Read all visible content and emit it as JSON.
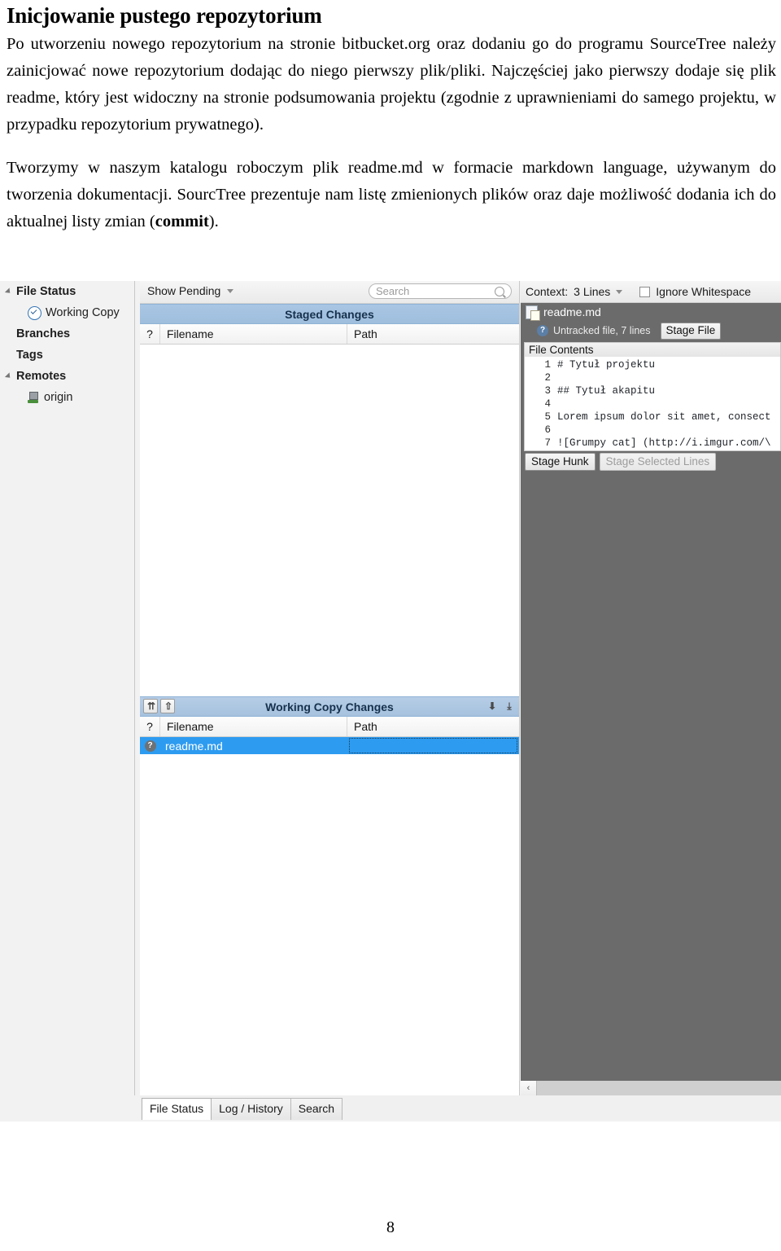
{
  "document": {
    "title": "Inicjowanie pustego repozytorium",
    "paragraph1": "Po utworzeniu nowego repozytorium na stronie bitbucket.org oraz dodaniu go do programu SourceTree należy zainicjować nowe repozytorium dodając do niego pierwszy plik/pliki. Najczęściej jako pierwszy dodaje się plik readme, który jest widoczny na stronie podsumowania projektu (zgodnie z uprawnieniami do samego projektu, w przypadku repozytorium prywatnego).",
    "paragraph2_pre": "Tworzymy w naszym katalogu roboczym plik readme.md w formacie markdown language, używanym do tworzenia dokumentacji. SourcTree prezentuje nam listę zmienionych plików oraz daje możliwość dodania ich do aktualnej listy zmian (",
    "paragraph2_bold": "commit",
    "paragraph2_post": ").",
    "page_number": "8"
  },
  "app": {
    "sidebar": {
      "items": [
        {
          "label": "File Status",
          "icon": "expand-triangle-icon",
          "level": "root"
        },
        {
          "label": "Working Copy",
          "icon": "check-circle-icon",
          "level": "child"
        },
        {
          "label": "Branches",
          "icon": "none",
          "level": "root"
        },
        {
          "label": "Tags",
          "icon": "none",
          "level": "root"
        },
        {
          "label": "Remotes",
          "icon": "expand-triangle-icon",
          "level": "root"
        },
        {
          "label": "origin",
          "icon": "server-icon",
          "level": "child"
        }
      ]
    },
    "middle": {
      "filter_label": "Show Pending",
      "search_placeholder": "Search",
      "search_value": "",
      "staged_section_title": "Staged Changes",
      "working_section_title": "Working Copy Changes",
      "columns": {
        "status": "?",
        "filename": "Filename",
        "path": "Path"
      },
      "staged_rows": [],
      "working_rows": [
        {
          "status": "?",
          "filename": "readme.md",
          "path": "",
          "selected": true
        }
      ],
      "unstage_all_icon": "double-up-arrow-icon",
      "unstage_icon": "up-arrow-icon",
      "stage_icon": "down-arrow-icon",
      "stage_all_icon": "double-down-arrow-icon"
    },
    "right": {
      "context_label": "Context:",
      "context_value": "3 Lines",
      "ignore_whitespace_label": "Ignore Whitespace",
      "ignore_whitespace_checked": false,
      "file_name": "readme.md",
      "file_status": "Untracked file, 7 lines",
      "stage_file_button": "Stage File",
      "contents_title": "File Contents",
      "lines": [
        {
          "n": "1",
          "text": "# Tytuł projektu"
        },
        {
          "n": "2",
          "text": ""
        },
        {
          "n": "3",
          "text": "## Tytuł akapitu"
        },
        {
          "n": "4",
          "text": ""
        },
        {
          "n": "5",
          "text": "Lorem ipsum dolor sit amet, consect"
        },
        {
          "n": "6",
          "text": ""
        },
        {
          "n": "7",
          "text": "![Grumpy cat] (http://i.imgur.com/\\"
        }
      ],
      "stage_hunk_button": "Stage Hunk",
      "stage_selected_lines_button": "Stage Selected Lines",
      "scroll_left_icon": "chevron-left-icon"
    },
    "tabs": [
      {
        "label": "File Status",
        "active": true
      },
      {
        "label": "Log / History",
        "active": false
      },
      {
        "label": "Search",
        "active": false
      }
    ],
    "colors": {
      "selection_blue": "#2d9bf0",
      "section_header_blue": "#a9c6e4",
      "diff_panel_gray": "#6b6b6b"
    }
  }
}
